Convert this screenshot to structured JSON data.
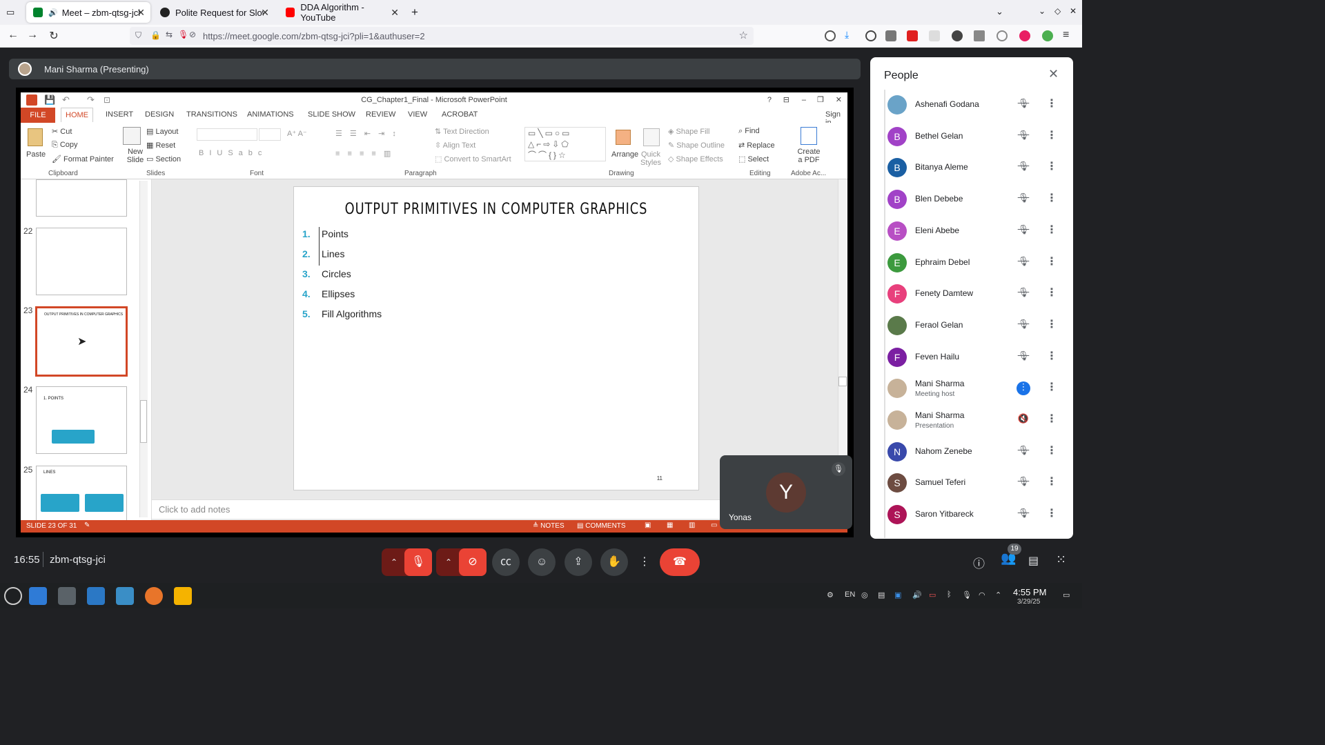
{
  "browser": {
    "tabs": [
      {
        "title": "Meet – zbm-qtsg-jci",
        "active": true
      },
      {
        "title": "Polite Request for Slower S",
        "active": false
      },
      {
        "title": "DDA Algorithm - YouTube",
        "active": false
      }
    ],
    "url": "https://meet.google.com/zbm-qtsg-jci?pli=1&authuser=2"
  },
  "meet": {
    "presenter_label": "Mani Sharma (Presenting)",
    "time": "16:55",
    "meeting_code": "zbm-qtsg-jci",
    "pip_initial": "Y",
    "pip_name": "Yonas",
    "participant_count": "19",
    "people_title": "People",
    "participants": [
      {
        "name": "Ashenafi Godana",
        "initial": "",
        "color": "#6aa3c8",
        "sub": "",
        "mic": "muted"
      },
      {
        "name": "Bethel Gelan",
        "initial": "B",
        "color": "#a142c7",
        "sub": "",
        "mic": "muted"
      },
      {
        "name": "Bitanya Aleme",
        "initial": "B",
        "color": "#1a5fa3",
        "sub": "",
        "mic": "muted"
      },
      {
        "name": "Blen Debebe",
        "initial": "B",
        "color": "#a142c7",
        "sub": "",
        "mic": "muted"
      },
      {
        "name": "Eleni Abebe",
        "initial": "E",
        "color": "#b84fc4",
        "sub": "",
        "mic": "muted"
      },
      {
        "name": "Ephraim Debel",
        "initial": "E",
        "color": "#3c9a3e",
        "sub": "",
        "mic": "muted"
      },
      {
        "name": "Fenety Damtew",
        "initial": "F",
        "color": "#e8407c",
        "sub": "",
        "mic": "muted"
      },
      {
        "name": "Feraol Gelan",
        "initial": "",
        "color": "#5a7a4a",
        "sub": "",
        "mic": "muted"
      },
      {
        "name": "Feven Hailu",
        "initial": "F",
        "color": "#7b1fa2",
        "sub": "",
        "mic": "muted"
      },
      {
        "name": "Mani Sharma",
        "initial": "",
        "color": "#c7b299",
        "sub": "Meeting host",
        "mic": "speaking"
      },
      {
        "name": "Mani Sharma",
        "initial": "",
        "color": "#c7b299",
        "sub": "Presentation",
        "mic": "audio-off"
      },
      {
        "name": "Nahom Zenebe",
        "initial": "N",
        "color": "#3949ab",
        "sub": "",
        "mic": "muted"
      },
      {
        "name": "Samuel Teferi",
        "initial": "S",
        "color": "#6d4c41",
        "sub": "",
        "mic": "muted"
      },
      {
        "name": "Saron Yitbareck",
        "initial": "S",
        "color": "#ad1457",
        "sub": "",
        "mic": "muted"
      }
    ]
  },
  "ppt": {
    "window_title": "CG_Chapter1_Final - Microsoft PowerPoint",
    "file_tab": "FILE",
    "tabs": [
      "HOME",
      "INSERT",
      "DESIGN",
      "TRANSITIONS",
      "ANIMATIONS",
      "SLIDE SHOW",
      "REVIEW",
      "VIEW",
      "ACROBAT"
    ],
    "sign_in": "Sign in",
    "ribbon": {
      "paste": "Paste",
      "cut": "Cut",
      "copy": "Copy",
      "format_painter": "Format Painter",
      "clipboard": "Clipboard",
      "new_slide": "New Slide",
      "layout": "Layout",
      "reset": "Reset",
      "section": "Section",
      "slides": "Slides",
      "font": "Font",
      "paragraph": "Paragraph",
      "text_direction": "Text Direction",
      "align_text": "Align Text",
      "convert_smartart": "Convert to SmartArt",
      "arrange": "Arrange",
      "quick_styles": "Quick Styles",
      "shape_fill": "Shape Fill",
      "shape_outline": "Shape Outline",
      "shape_effects": "Shape Effects",
      "drawing": "Drawing",
      "find": "Find",
      "replace": "Replace",
      "select": "Select",
      "editing": "Editing",
      "create_pdf": "Create a PDF",
      "adobe": "Adobe Ac..."
    },
    "thumbnails": [
      {
        "num": "22",
        "title": ""
      },
      {
        "num": "23",
        "title": "OUTPUT PRIMITIVES IN COMPUTER GRAPHICS"
      },
      {
        "num": "24",
        "title": "1. POINTS"
      },
      {
        "num": "25",
        "title": "LINES"
      }
    ],
    "slide": {
      "title": "OUTPUT PRIMITIVES IN COMPUTER GRAPHICS",
      "items": [
        {
          "n": "1.",
          "t": "Points"
        },
        {
          "n": "2.",
          "t": "Lines"
        },
        {
          "n": "3.",
          "t": "Circles"
        },
        {
          "n": "4.",
          "t": "Ellipses"
        },
        {
          "n": "5.",
          "t": "Fill Algorithms"
        }
      ],
      "page_num": "11"
    },
    "notes_placeholder": "Click to add notes",
    "status": {
      "slide": "SLIDE 23 OF 31",
      "notes": "NOTES",
      "comments": "COMMENTS"
    }
  },
  "taskbar": {
    "lang": "EN",
    "time": "4:55 PM",
    "date": "3/29/25"
  }
}
